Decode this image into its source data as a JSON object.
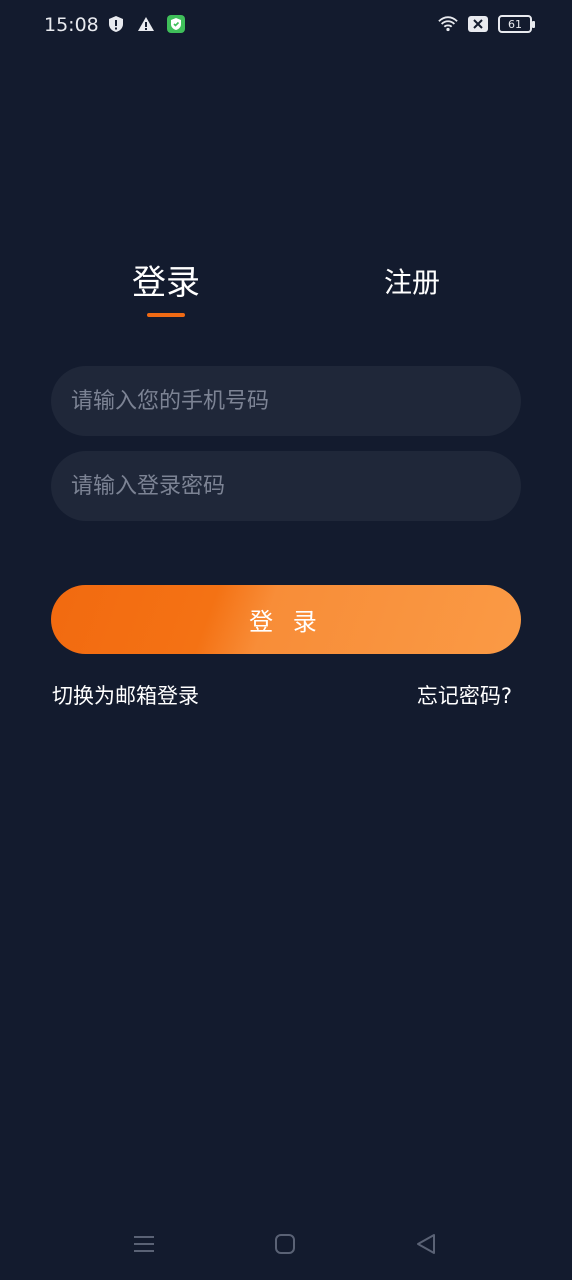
{
  "status_bar": {
    "time": "15:08",
    "battery_level": "61",
    "icons": [
      "shield-alert-icon",
      "warning-icon",
      "security-app-icon",
      "wifi-icon",
      "sim-off-icon",
      "battery-icon"
    ]
  },
  "tabs": {
    "login_label": "登录",
    "register_label": "注册",
    "active": "login"
  },
  "form": {
    "phone_placeholder": "请输入您的手机号码",
    "phone_value": "",
    "password_placeholder": "请输入登录密码",
    "password_value": "",
    "login_button_label": "登 录"
  },
  "links": {
    "switch_email_label": "切换为邮箱登录",
    "forgot_password_label": "忘记密码?"
  },
  "colors": {
    "background": "#131b2e",
    "input_background": "#1f2739",
    "accent": "#f06a14",
    "accent_light": "#fa9a45"
  },
  "nav_bar": {
    "icons": [
      "menu-icon",
      "home-icon",
      "back-icon"
    ]
  }
}
